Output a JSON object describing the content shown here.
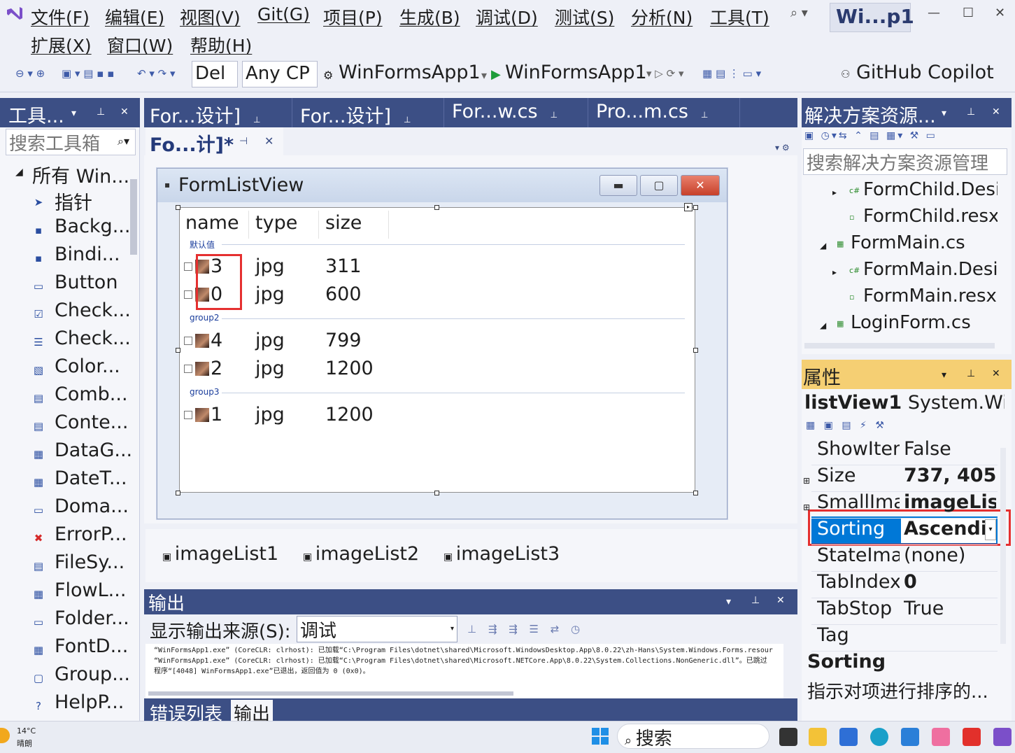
{
  "menu": {
    "items": [
      "文件(F)",
      "编辑(E)",
      "视图(V)",
      "Git(G)",
      "项目(P)",
      "生成(B)",
      "调试(D)",
      "测试(S)",
      "分析(N)",
      "工具(T)"
    ],
    "items2": [
      "扩展(X)",
      "窗口(W)",
      "帮助(H)"
    ],
    "solution_badge": "Wi...p1"
  },
  "toolbar": {
    "config": "Del",
    "platform": "Any CP",
    "project": "WinFormsApp1",
    "run": "WinFormsApp1",
    "copilot": "GitHub Copilot"
  },
  "toolbox": {
    "title": "工具...",
    "search_placeholder": "搜索工具箱",
    "group": "所有 Win...",
    "items": [
      "指针",
      "Backg...",
      "Bindi...",
      "Button",
      "Check...",
      "Check...",
      "Color...",
      "Comb...",
      "Conte...",
      "DataG...",
      "DateT...",
      "Doma...",
      "ErrorP...",
      "FileSy...",
      "FlowL...",
      "Folder...",
      "FontD...",
      "Group...",
      "HelpP..."
    ]
  },
  "tabs": {
    "items": [
      "For...设计]",
      "For...设计]",
      "For...w.cs",
      "Pro...m.cs"
    ],
    "active": "Fo...计]*"
  },
  "form": {
    "title": "FormListView"
  },
  "listview": {
    "columns": [
      "name",
      "type",
      "size"
    ],
    "groups": [
      {
        "name": "默认值",
        "rows": [
          {
            "name": "3",
            "type": "jpg",
            "size": "311"
          },
          {
            "name": "0",
            "type": "jpg",
            "size": "600"
          }
        ]
      },
      {
        "name": "group2",
        "rows": [
          {
            "name": "4",
            "type": "jpg",
            "size": "799"
          },
          {
            "name": "2",
            "type": "jpg",
            "size": "1200"
          }
        ]
      },
      {
        "name": "group3",
        "rows": [
          {
            "name": "1",
            "type": "jpg",
            "size": "1200"
          }
        ]
      }
    ]
  },
  "tray": {
    "items": [
      "imageList1",
      "imageList2",
      "imageList3"
    ]
  },
  "output": {
    "title": "输出",
    "source_label": "显示输出来源(S):",
    "source_value": "调试",
    "lines": [
      "“WinFormsApp1.exe” (CoreCLR: clrhost): 已加载“C:\\Program Files\\dotnet\\shared\\Microsoft.WindowsDesktop.App\\8.0.22\\zh-Hans\\System.Windows.Forms.resour",
      "“WinFormsApp1.exe” (CoreCLR: clrhost): 已加载“C:\\Program Files\\dotnet\\shared\\Microsoft.NETCore.App\\8.0.22\\System.Collections.NonGeneric.dll”。已跳过",
      "程序“[4048] WinFormsApp1.exe”已退出，返回值为 0 (0x0)。"
    ],
    "bottom_tabs": [
      "错误列表",
      "输出"
    ]
  },
  "solution_explorer": {
    "title": "解决方案资源...",
    "search_placeholder": "搜索解决方案资源管理",
    "items": [
      "FormChild.Desi",
      "FormChild.resx",
      "FormMain.cs",
      "FormMain.Desi",
      "FormMain.resx",
      "LoginForm.cs"
    ]
  },
  "properties": {
    "title": "属性",
    "object_name": "listView1",
    "object_type": "System.Win",
    "rows": [
      {
        "name": "ShowIten",
        "value": "False"
      },
      {
        "name": "Size",
        "value": "737, 405"
      },
      {
        "name": "SmallIma",
        "value": "imageList"
      },
      {
        "name": "Sorting",
        "value": "Ascendir"
      },
      {
        "name": "StateIma",
        "value": "(none)"
      },
      {
        "name": "TabIndex",
        "value": "0"
      },
      {
        "name": "TabStop",
        "value": "True"
      },
      {
        "name": "Tag",
        "value": ""
      }
    ],
    "desc_title": "Sorting",
    "desc_text": "指示对项进行排序的..."
  },
  "taskbar": {
    "weather_temp": "14°C",
    "weather_desc": "晴朗",
    "search": "搜索"
  },
  "colors": {
    "accent": "#3c4f85",
    "selection": "#0078d7",
    "highlight": "#e53030",
    "prop_header": "#f5cf73"
  }
}
